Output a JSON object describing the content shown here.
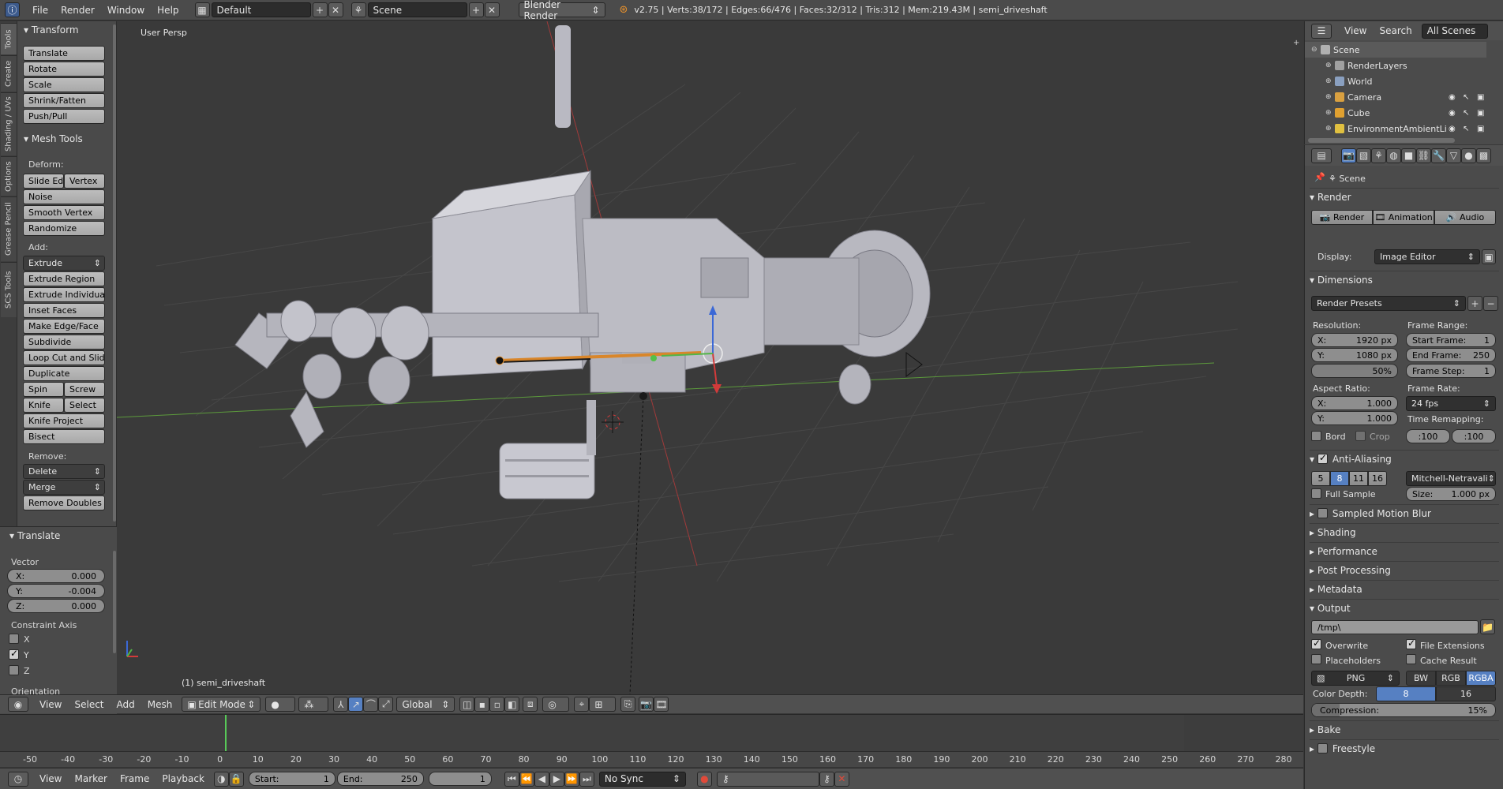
{
  "topbar": {
    "menus": [
      "File",
      "Render",
      "Window",
      "Help"
    ],
    "layout": "Default",
    "scene": "Scene",
    "engine": "Blender Render",
    "stats": "v2.75 | Verts:38/172 | Edges:66/476 | Faces:32/312 | Tris:312 | Mem:219.43M | semi_driveshaft"
  },
  "toolshelf": {
    "tabs": [
      "Tools",
      "Create",
      "Shading / UVs",
      "Options",
      "Grease Pencil",
      "SCS Tools"
    ],
    "transform": {
      "title": "Transform",
      "buttons": [
        "Translate",
        "Rotate",
        "Scale",
        "Shrink/Fatten",
        "Push/Pull"
      ]
    },
    "mesh_tools": {
      "title": "Mesh Tools",
      "deform_label": "Deform:",
      "slide_edge": "Slide Ed",
      "vertex": "Vertex",
      "noise": "Noise",
      "smooth_vertex": "Smooth Vertex",
      "randomize": "Randomize",
      "add_label": "Add:",
      "extrude": "Extrude",
      "extrude_region": "Extrude Region",
      "extrude_individual": "Extrude Individual",
      "inset_faces": "Inset Faces",
      "make_edge_face": "Make Edge/Face",
      "subdivide": "Subdivide",
      "loop_cut": "Loop Cut and Slide",
      "duplicate": "Duplicate",
      "spin": "Spin",
      "screw": "Screw",
      "knife": "Knife",
      "select": "Select",
      "knife_project": "Knife Project",
      "bisect": "Bisect",
      "remove_label": "Remove:",
      "delete": "Delete",
      "merge": "Merge",
      "remove_doubles": "Remove Doubles"
    },
    "operator": {
      "title": "Translate",
      "vector_label": "Vector",
      "x_label": "X:",
      "x": "0.000",
      "y_label": "Y:",
      "y": "-0.004",
      "z_label": "Z:",
      "z": "0.000",
      "constraint_label": "Constraint Axis",
      "cx": "X",
      "cy": "Y",
      "cz": "Z",
      "cx_on": false,
      "cy_on": true,
      "cz_on": false,
      "orientation_label": "Orientation"
    }
  },
  "viewport": {
    "view_name": "User Persp",
    "object_name": "(1) semi_driveshaft",
    "header": {
      "view": "View",
      "select": "Select",
      "add": "Add",
      "mesh": "Mesh",
      "mode": "Edit Mode",
      "orientation": "Global"
    }
  },
  "outliner": {
    "menus": [
      "View",
      "Search"
    ],
    "filter": "All Scenes",
    "items": [
      {
        "label": "Scene",
        "indent": 0,
        "color": "#b0b0b0"
      },
      {
        "label": "RenderLayers",
        "indent": 1,
        "color": "#a0a0a0"
      },
      {
        "label": "World",
        "indent": 1,
        "color": "#8aa0c0"
      },
      {
        "label": "Camera",
        "indent": 1,
        "color": "#d9a040"
      },
      {
        "label": "Cube",
        "indent": 1,
        "color": "#e0a030"
      },
      {
        "label": "EnvironmentAmbientLi",
        "indent": 1,
        "color": "#e0c040"
      }
    ]
  },
  "properties": {
    "breadcrumb": "Scene",
    "render_section": "Render",
    "render_btn": "Render",
    "animation_btn": "Animation",
    "audio_btn": "Audio",
    "display_label": "Display:",
    "display_value": "Image Editor",
    "dimensions_section": "Dimensions",
    "render_presets": "Render Presets",
    "resolution_label": "Resolution:",
    "res_x_label": "X:",
    "res_x": "1920 px",
    "res_y_label": "Y:",
    "res_y": "1080 px",
    "res_pct": "50%",
    "frame_range_label": "Frame Range:",
    "start_frame_label": "Start Frame:",
    "start_frame": "1",
    "end_frame_label": "End Frame:",
    "end_frame": "250",
    "frame_step_label": "Frame Step:",
    "frame_step": "1",
    "aspect_label": "Aspect Ratio:",
    "asp_x_label": "X:",
    "asp_x": "1.000",
    "asp_y_label": "Y:",
    "asp_y": "1.000",
    "frame_rate_label": "Frame Rate:",
    "frame_rate": "24 fps",
    "time_remap_label": "Time Remapping:",
    "remap_old": ":100",
    "remap_new": ":100",
    "bord": "Bord",
    "crop": "Crop",
    "aa_section": "Anti-Aliasing",
    "aa_samples": [
      "5",
      "8",
      "11",
      "16"
    ],
    "aa_filter": "Mitchell-Netravali",
    "full_sample": "Full Sample",
    "size_label": "Size:",
    "size_value": "1.000 px",
    "motion_blur": "Sampled Motion Blur",
    "shading": "Shading",
    "performance": "Performance",
    "post_processing": "Post Processing",
    "metadata": "Metadata",
    "output_section": "Output",
    "output_path": "/tmp\\",
    "overwrite": "Overwrite",
    "file_extensions": "File Extensions",
    "placeholders": "Placeholders",
    "cache_result": "Cache Result",
    "format": "PNG",
    "bw": "BW",
    "rgb": "RGB",
    "rgba": "RGBA",
    "color_depth_label": "Color Depth:",
    "depth_8": "8",
    "depth_16": "16",
    "compression_label": "Compression:",
    "compression": "15%",
    "compression_frac": 0.15,
    "bake": "Bake",
    "freestyle": "Freestyle"
  },
  "timeline": {
    "ticks": [
      "-50",
      "-40",
      "-30",
      "-20",
      "-10",
      "0",
      "10",
      "20",
      "30",
      "40",
      "50",
      "60",
      "70",
      "80",
      "90",
      "100",
      "110",
      "120",
      "130",
      "140",
      "150",
      "160",
      "170",
      "180",
      "190",
      "200",
      "210",
      "220",
      "230",
      "240",
      "250",
      "260",
      "270",
      "280"
    ],
    "current_frame_marker": "0",
    "header": {
      "view": "View",
      "marker": "Marker",
      "frame": "Frame",
      "playback": "Playback",
      "start_label": "Start:",
      "start": "1",
      "end_label": "End:",
      "end": "250",
      "current": "1",
      "sync": "No Sync"
    }
  }
}
